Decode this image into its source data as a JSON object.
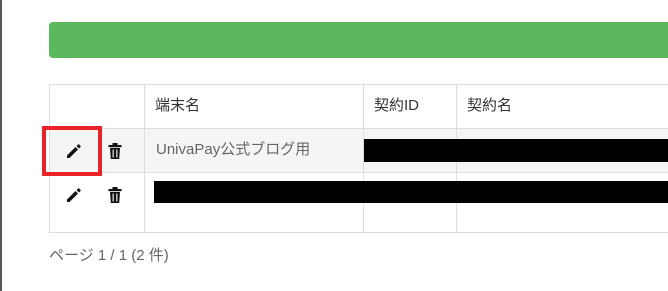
{
  "table": {
    "columns": [
      "",
      "端末名",
      "契約ID",
      "契約名"
    ],
    "rows": [
      {
        "terminal_name": "UnivaPay公式ブログ用",
        "contract_id": "",
        "contract_name": ""
      },
      {
        "terminal_name": "",
        "contract_id": "",
        "contract_name": ""
      }
    ]
  },
  "pagination": {
    "text": "ページ 1 / 1 (2 件)"
  },
  "colors": {
    "banner": "#5cb85c",
    "highlight": "#e8232a",
    "redaction": "#000000"
  },
  "icons": {
    "edit": "pencil-icon",
    "delete": "trash-icon"
  }
}
